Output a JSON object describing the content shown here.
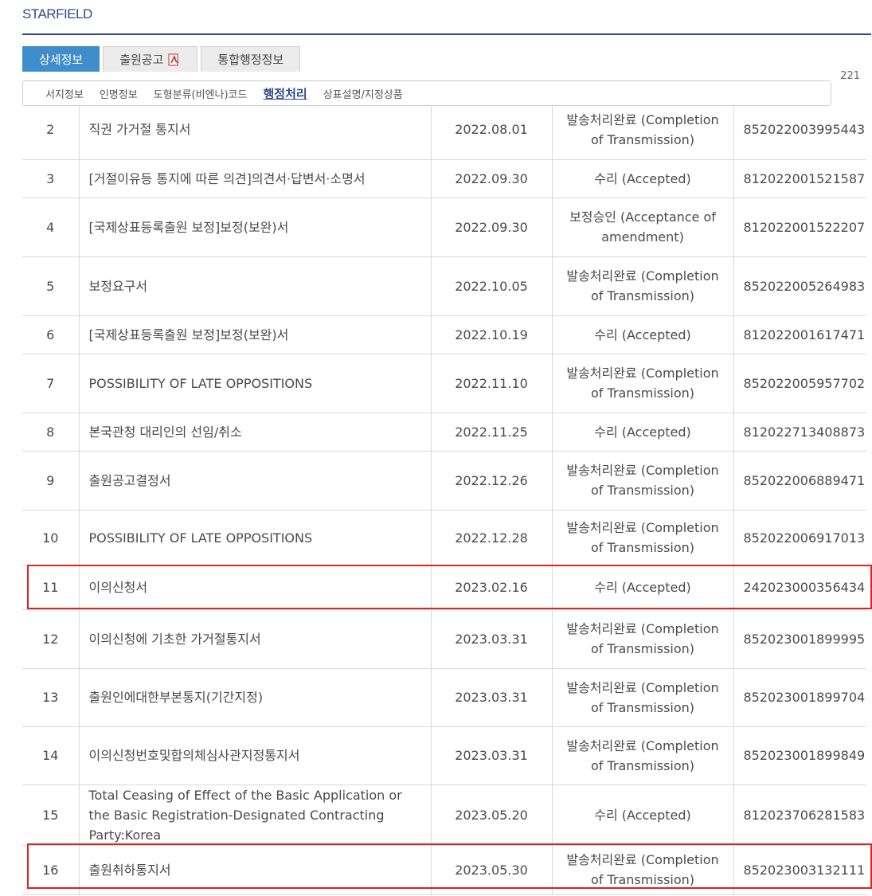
{
  "header": {
    "brand": "STARFIELD"
  },
  "tabs": [
    {
      "label": "상세정보",
      "active": true
    },
    {
      "label": "출원공고",
      "icon": "pdf-icon"
    },
    {
      "label": "통합행정정보"
    }
  ],
  "subnav": [
    {
      "label": "서지정보"
    },
    {
      "label": "인명정보"
    },
    {
      "label": "도형분류(비엔나)코드"
    },
    {
      "label": "행정처리",
      "active": true
    },
    {
      "label": "상표설명/지정상품"
    }
  ],
  "partial_row": {
    "number_tail": "221"
  },
  "rows": [
    {
      "no": "2",
      "doc": "직권 가거절 통지서",
      "date": "2022.08.01",
      "status": "발송처리완료 (Completion of Transmission)",
      "number": "852022003995443"
    },
    {
      "no": "3",
      "doc": "[거절이유등 통지에 따른 의견]의견서·답변서·소명서",
      "date": "2022.09.30",
      "status": "수리 (Accepted)",
      "number": "812022001521587"
    },
    {
      "no": "4",
      "doc": "[국제상표등록출원 보정]보정(보완)서",
      "date": "2022.09.30",
      "status": "보정승인 (Acceptance of amendment)",
      "number": "812022001522207"
    },
    {
      "no": "5",
      "doc": "보정요구서",
      "date": "2022.10.05",
      "status": "발송처리완료 (Completion of Transmission)",
      "number": "852022005264983"
    },
    {
      "no": "6",
      "doc": "[국제상표등록출원 보정]보정(보완)서",
      "date": "2022.10.19",
      "status": "수리 (Accepted)",
      "number": "812022001617471"
    },
    {
      "no": "7",
      "doc": "POSSIBILITY OF LATE OPPOSITIONS",
      "date": "2022.11.10",
      "status": "발송처리완료 (Completion of Transmission)",
      "number": "852022005957702"
    },
    {
      "no": "8",
      "doc": "본국관청 대리인의 선임/취소",
      "date": "2022.11.25",
      "status": "수리 (Accepted)",
      "number": "812022713408873"
    },
    {
      "no": "9",
      "doc": "출원공고결정서",
      "date": "2022.12.26",
      "status": "발송처리완료 (Completion of Transmission)",
      "number": "852022006889471"
    },
    {
      "no": "10",
      "doc": "POSSIBILITY OF LATE OPPOSITIONS",
      "date": "2022.12.28",
      "status": "발송처리완료 (Completion of Transmission)",
      "number": "852022006917013"
    },
    {
      "no": "11",
      "doc": "이의신청서",
      "date": "2023.02.16",
      "status": "수리 (Accepted)",
      "number": "242023000356434"
    },
    {
      "no": "12",
      "doc": "이의신청에 기초한 가거절통지서",
      "date": "2023.03.31",
      "status": "발송처리완료 (Completion of Transmission)",
      "number": "852023001899995"
    },
    {
      "no": "13",
      "doc": "출원인에대한부본통지(기간지정)",
      "date": "2023.03.31",
      "status": "발송처리완료 (Completion of Transmission)",
      "number": "852023001899704"
    },
    {
      "no": "14",
      "doc": "이의신청번호및합의체심사관지정통지서",
      "date": "2023.03.31",
      "status": "발송처리완료 (Completion of Transmission)",
      "number": "852023001899849"
    },
    {
      "no": "15",
      "doc": "Total Ceasing of Effect of the Basic Application or the Basic Registration-Designated Contracting Party:Korea",
      "date": "2023.05.20",
      "status": "수리 (Accepted)",
      "number": "812023706281583"
    },
    {
      "no": "16",
      "doc": "출원취하통지서",
      "date": "2023.05.30",
      "status": "발송처리완료 (Completion of Transmission)",
      "number": "852023003132111"
    }
  ]
}
